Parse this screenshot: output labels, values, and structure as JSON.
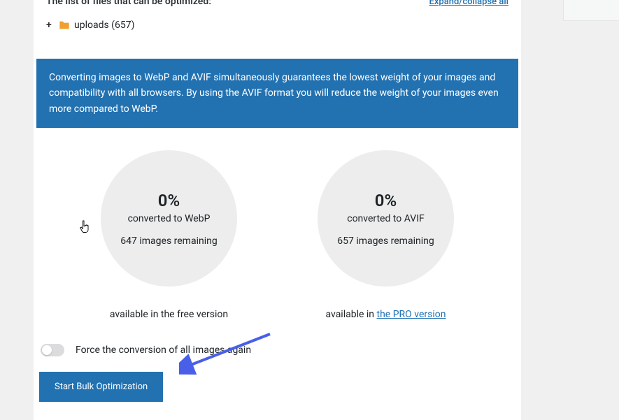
{
  "files": {
    "header": "The list of files that can be optimized:",
    "expand_link": "Expand/collapse all",
    "folder_label": "uploads (657)"
  },
  "banner": {
    "text": "Converting images to WebP and AVIF simultaneously guarantees the lowest weight of your images and compatibility with all browsers. By using the AVIF format you will reduce the weight of your images even more compared to WebP."
  },
  "stats": {
    "webp": {
      "percent": "0%",
      "label": "converted to WebP",
      "remaining": "647 images remaining",
      "caption": "available in the free version"
    },
    "avif": {
      "percent": "0%",
      "label": "converted to AVIF",
      "remaining": "657 images remaining",
      "caption_prefix": "available in ",
      "caption_link": "the PRO version"
    }
  },
  "toggle": {
    "label": "Force the conversion of all images again"
  },
  "actions": {
    "start_label": "Start Bulk Optimization"
  }
}
